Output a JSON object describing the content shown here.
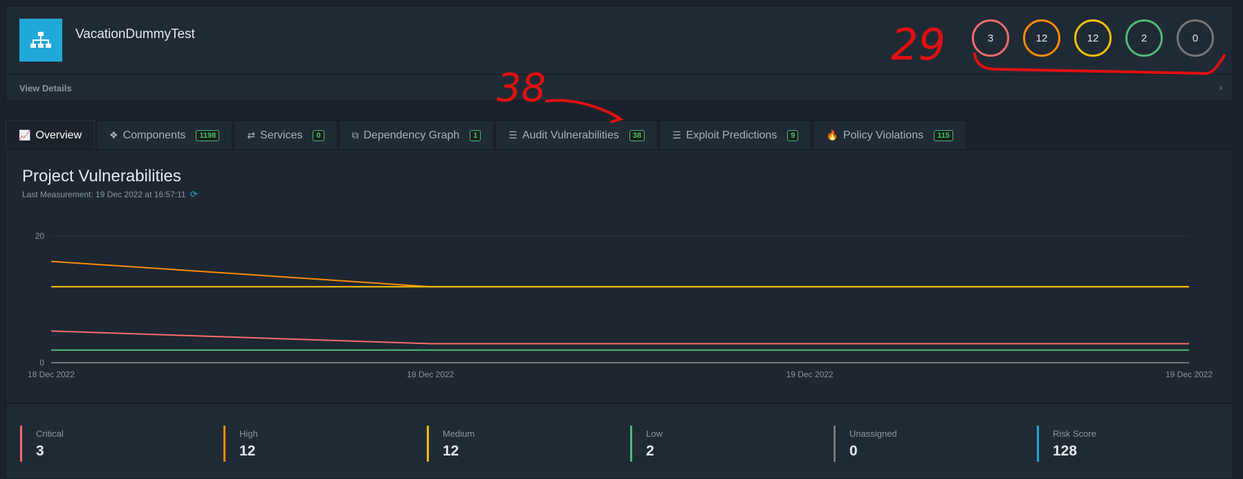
{
  "project": {
    "name": "VacationDummyTest",
    "view_details": "View Details",
    "severity_counts": [
      {
        "name": "critical",
        "value": "3",
        "color": "#f86c6b"
      },
      {
        "name": "high",
        "value": "12",
        "color": "#fd8c00"
      },
      {
        "name": "medium",
        "value": "12",
        "color": "#ffc107"
      },
      {
        "name": "low",
        "value": "2",
        "color": "#4dbd74"
      },
      {
        "name": "unassigned",
        "value": "0",
        "color": "#777777"
      }
    ]
  },
  "tabs": [
    {
      "label": "Overview",
      "icon": "line-chart-icon",
      "glyph": "📈",
      "badge": ""
    },
    {
      "label": "Components",
      "icon": "cubes-icon",
      "glyph": "❖",
      "badge": "1198"
    },
    {
      "label": "Services",
      "icon": "exchange-icon",
      "glyph": "⇄",
      "badge": "0"
    },
    {
      "label": "Dependency Graph",
      "icon": "sitemap-icon",
      "glyph": "⧉",
      "badge": "1"
    },
    {
      "label": "Audit Vulnerabilities",
      "icon": "tasks-icon",
      "glyph": "☰",
      "badge": "38"
    },
    {
      "label": "Exploit Predictions",
      "icon": "tasks-icon",
      "glyph": "☰",
      "badge": "9"
    },
    {
      "label": "Policy Violations",
      "icon": "fire-icon",
      "glyph": "🔥",
      "badge": "115"
    }
  ],
  "panel": {
    "title": "Project Vulnerabilities",
    "subtitle": "Last Measurement: 19 Dec 2022 at 16:57:11"
  },
  "chart_data": {
    "type": "line",
    "x": [
      "18 Dec 2022",
      "18 Dec 2022",
      "19 Dec 2022",
      "19 Dec 2022"
    ],
    "x_positions": [
      0,
      1,
      2,
      3
    ],
    "ylim": [
      0,
      20
    ],
    "y_ticks": [
      "20",
      "0"
    ],
    "grid": true,
    "series": [
      {
        "key": "high",
        "color": "#fd8c00",
        "points": [
          [
            0,
            16
          ],
          [
            1,
            12
          ],
          [
            2,
            12
          ],
          [
            3,
            12
          ]
        ]
      },
      {
        "key": "medium",
        "color": "#ffc107",
        "points": [
          [
            0,
            12
          ],
          [
            1,
            12
          ],
          [
            2,
            12
          ],
          [
            3,
            12
          ]
        ]
      },
      {
        "key": "critical",
        "color": "#f86c6b",
        "points": [
          [
            0,
            5
          ],
          [
            1,
            3
          ],
          [
            2,
            3
          ],
          [
            3,
            3
          ]
        ]
      },
      {
        "key": "low",
        "color": "#4dbd74",
        "points": [
          [
            0,
            2
          ],
          [
            1,
            2
          ],
          [
            2,
            2
          ],
          [
            3,
            2
          ]
        ]
      },
      {
        "key": "unassigned",
        "color": "#777777",
        "points": [
          [
            0,
            0
          ],
          [
            1,
            0
          ],
          [
            2,
            0
          ],
          [
            3,
            0
          ]
        ]
      }
    ]
  },
  "totals": [
    {
      "label": "Critical",
      "value": "3",
      "color": "#f86c6b"
    },
    {
      "label": "High",
      "value": "12",
      "color": "#fd8c00"
    },
    {
      "label": "Medium",
      "value": "12",
      "color": "#ffc107"
    },
    {
      "label": "Low",
      "value": "2",
      "color": "#4dbd74"
    },
    {
      "label": "Unassigned",
      "value": "0",
      "color": "#777777"
    },
    {
      "label": "Risk Score",
      "value": "128",
      "color": "#20a8d8"
    }
  ],
  "annotations": {
    "count_note": "29",
    "audit_note": "38"
  }
}
